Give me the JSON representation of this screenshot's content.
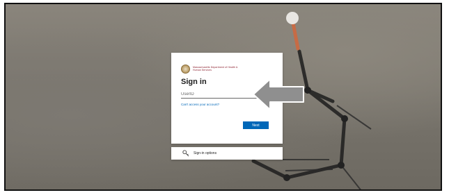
{
  "background": {
    "description_icon": "molecular-model-background"
  },
  "signin": {
    "org_name": "Massachusetts Department of Health & Human Services",
    "title": "Sign in",
    "userid_placeholder": "UserID",
    "help_link": "Can't access your account?",
    "next_label": "Next"
  },
  "options": {
    "icon": "key-icon",
    "label": "Sign-in options"
  },
  "overlay": {
    "icon": "left-arrow-icon"
  },
  "colors": {
    "primary": "#0067b8",
    "org_text": "#8b1d2c",
    "arrow_fill": "#8f8f8f"
  }
}
